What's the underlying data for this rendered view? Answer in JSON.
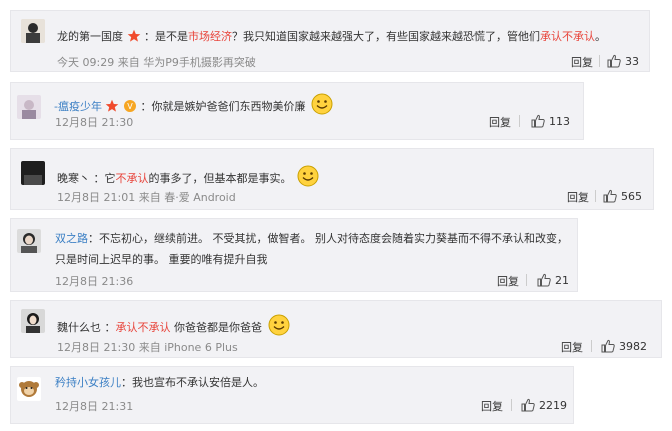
{
  "comments": [
    {
      "user": "龙的第一国度",
      "colon": "：",
      "text_a": "是不是",
      "hl_1": "市场经济",
      "text_b": "？我只知道国家越来越强大了，有些国家越来越恐慌了，管他们",
      "hl_2": "承认不承认",
      "text_c": "。",
      "time": "今天 09:29",
      "source": "来自 华为P9手机摄影再突破",
      "reply": "回复",
      "likes": "33"
    },
    {
      "user": "-瘟疫少年",
      "colon": "：",
      "text_a": "你就是嫉妒爸爸们东西物美价廉",
      "time": "12月8日 21:30",
      "reply": "回复",
      "likes": "113"
    },
    {
      "user": "晚寒丶",
      "colon": "：",
      "text_a": "它",
      "hl_1": "不承认",
      "text_b": "的事多了，但基本都是事实。",
      "time": "12月8日 21:01",
      "source": "来自 春·爱 Android",
      "reply": "回复",
      "likes": "565"
    },
    {
      "user": "双之路",
      "colon": "：",
      "text_a": "不忘初心，继续前进。 不受其扰，做智者。 别人对待态度会随着实力葵基而不得不承认和改变，只是时间上迟早的事。 重要的唯有提升自我",
      "time": "12月8日 21:36",
      "reply": "回复",
      "likes": "21"
    },
    {
      "user": "魏什么乜",
      "colon": "：",
      "hl_1": "承认不承认",
      "text_a": " 你爸爸都是你爸爸",
      "time": "12月8日 21:30",
      "source": "来自 iPhone 6 Plus",
      "reply": "回复",
      "likes": "3982"
    },
    {
      "user": "矜持小女孩儿",
      "colon": "：",
      "text_a": "我也宣布不承认安倍是人。",
      "time": "12月8日 21:31",
      "reply": "回复",
      "likes": "2219"
    }
  ],
  "colors": {
    "highlight": "#e8453c",
    "link": "#3b7fc4",
    "meta": "#8a8a8a",
    "card": "#f2f2f5"
  },
  "icons": [
    "thumbs-up-icon",
    "smiley-icon",
    "vip-star-icon"
  ]
}
